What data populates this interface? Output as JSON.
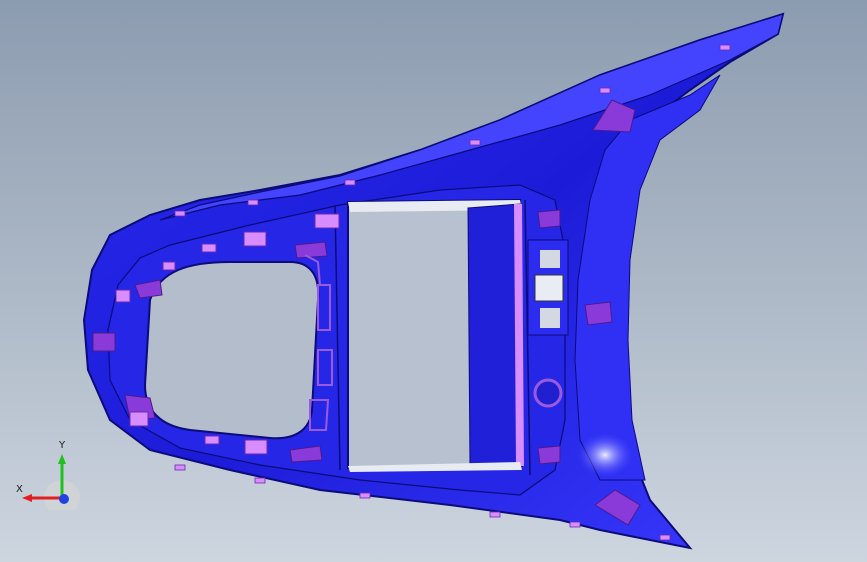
{
  "app": {
    "title": ""
  },
  "viewport": {
    "background_top": "#8c9cb0",
    "background_bottom": "#cdd5df"
  },
  "model": {
    "description_name": "console-trim-part",
    "body_color": "#2020e0",
    "body_edge_color": "#0b0b7a",
    "face_highlight_color": "#3b3bff",
    "clip_color": "#8a3ad8",
    "clip_light_color": "#d78cff",
    "opening_fill": "#b3bdcc"
  },
  "triad": {
    "x_label": "X",
    "y_label": "Y",
    "x_color": "#e02020",
    "y_color": "#20c020",
    "z_color": "#2040e0"
  }
}
